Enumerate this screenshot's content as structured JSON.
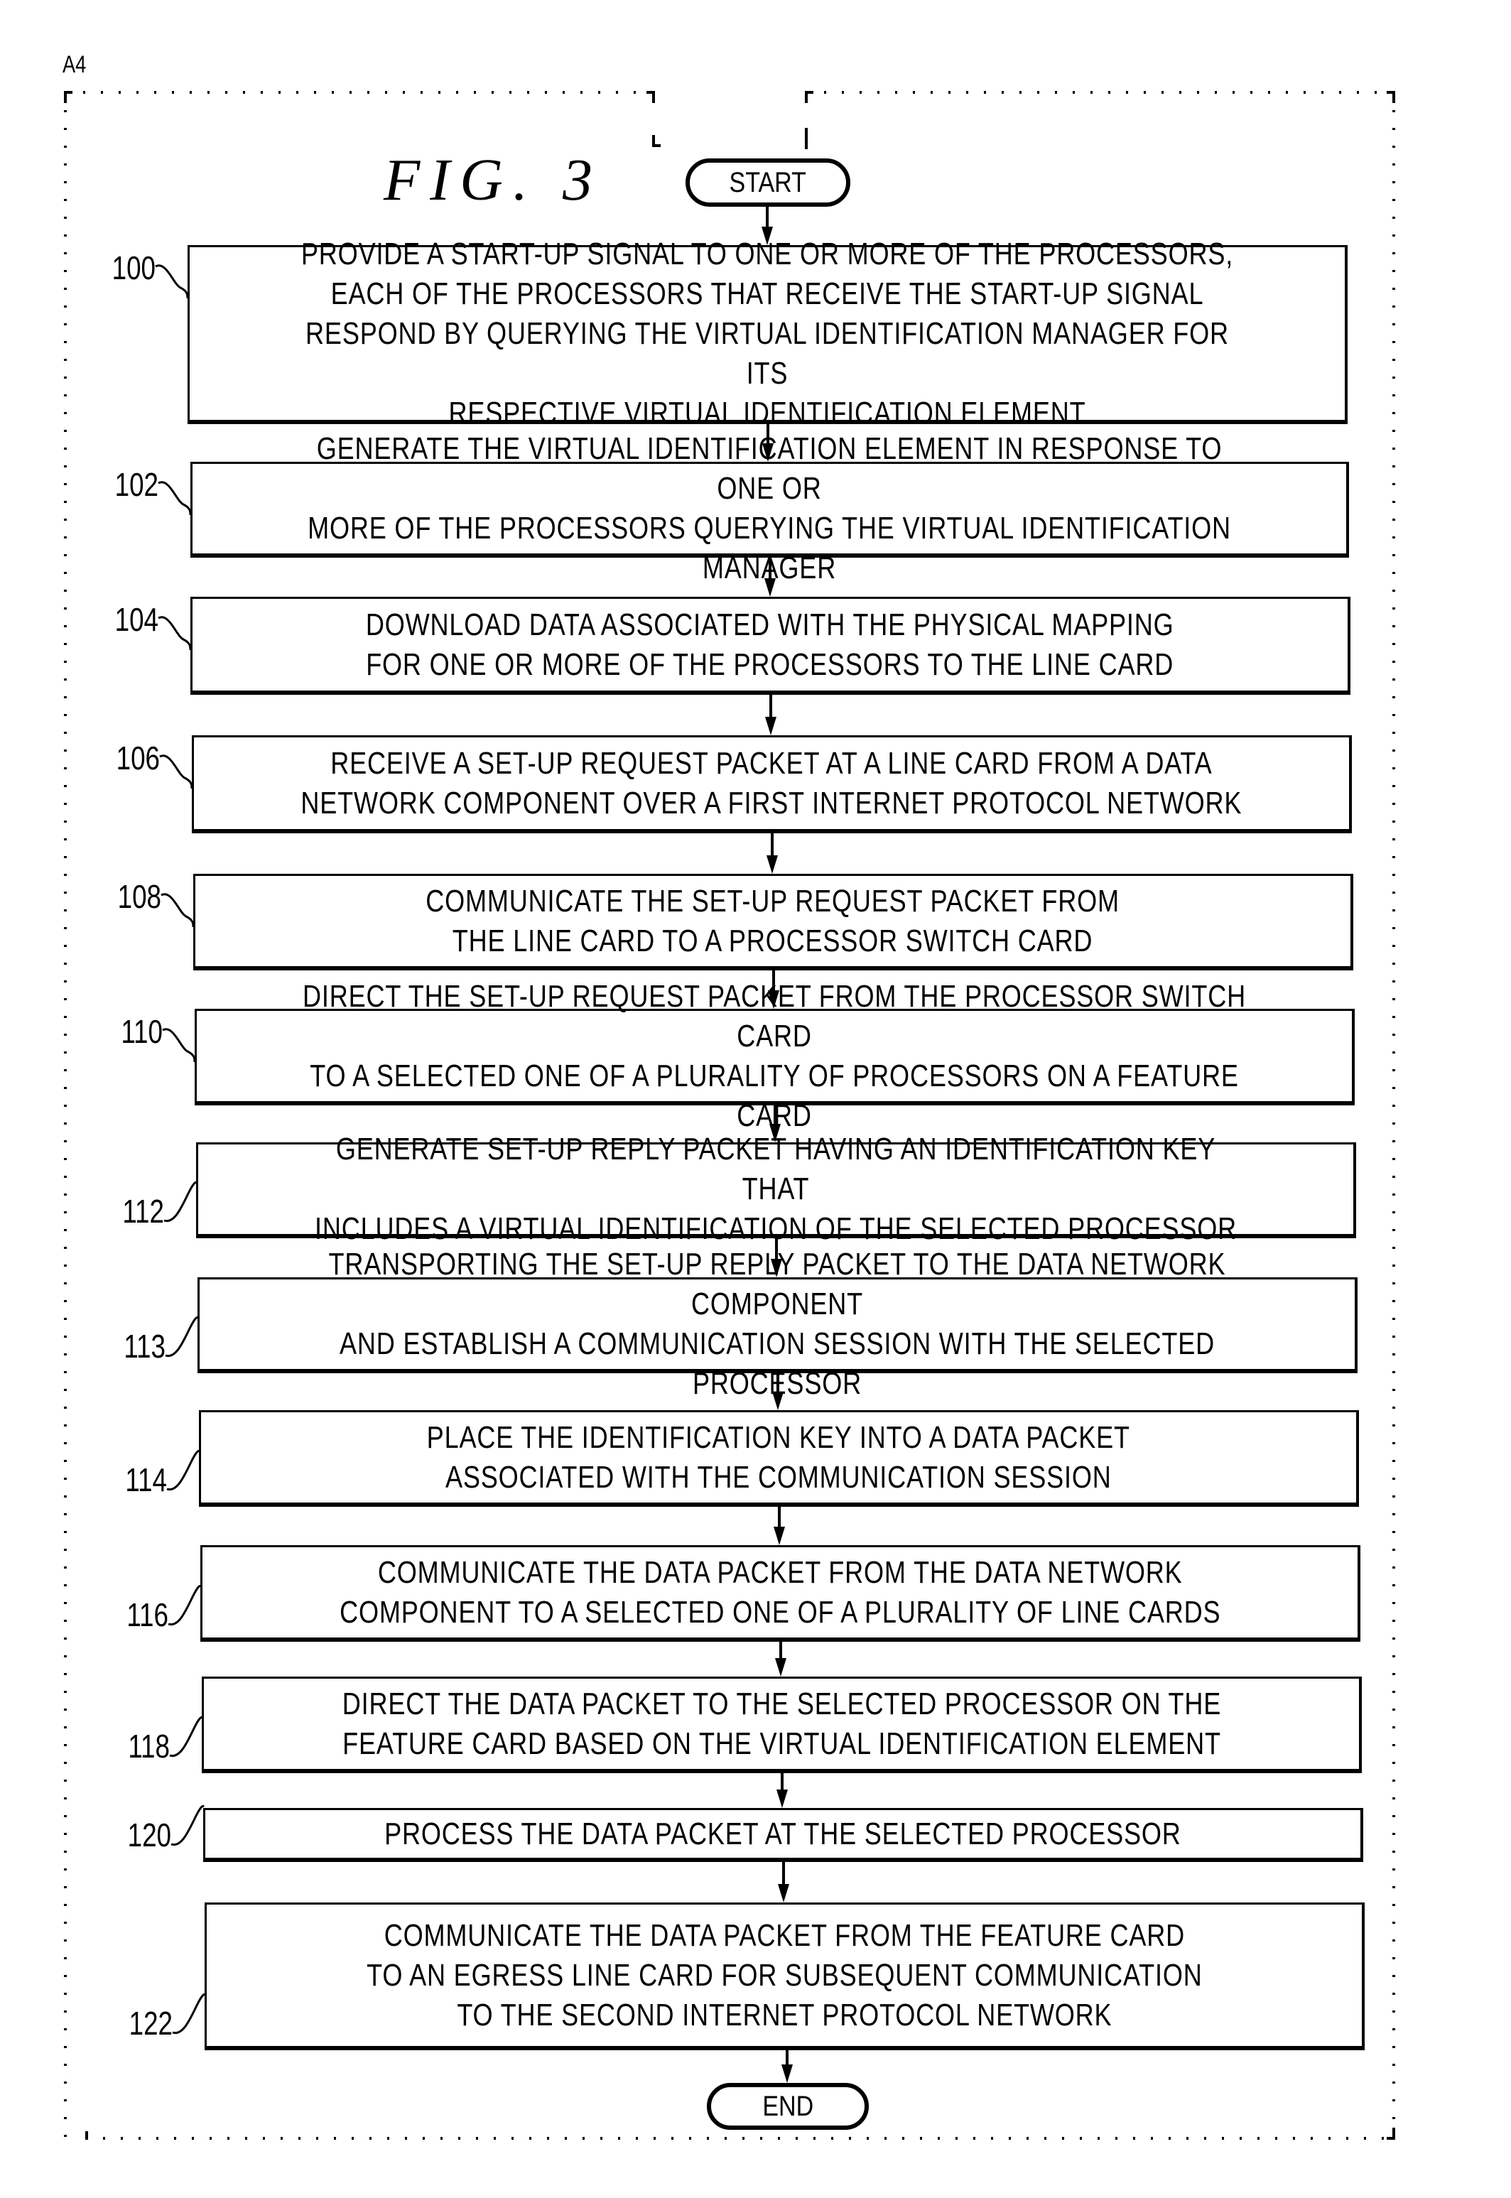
{
  "sheet_label": "A4",
  "figure_title": "FIG. 3",
  "start_label": "START",
  "end_label": "END",
  "steps": [
    {
      "id": "100",
      "text": "PROVIDE A START-UP SIGNAL TO ONE OR MORE OF THE PROCESSORS,\nEACH OF THE PROCESSORS THAT RECEIVE THE START-UP SIGNAL\nRESPOND BY QUERYING THE VIRTUAL IDENTIFICATION MANAGER FOR ITS\nRESPECTIVE VIRTUAL IDENTIFICATION ELEMENT",
      "label_side": "top"
    },
    {
      "id": "102",
      "text": "GENERATE THE VIRTUAL IDENTIFICATION ELEMENT IN RESPONSE TO ONE OR\nMORE OF THE PROCESSORS QUERYING THE VIRTUAL IDENTIFICATION MANAGER",
      "label_side": "top"
    },
    {
      "id": "104",
      "text": "DOWNLOAD DATA ASSOCIATED WITH THE PHYSICAL MAPPING\nFOR ONE OR MORE OF THE PROCESSORS TO THE LINE CARD",
      "label_side": "top"
    },
    {
      "id": "106",
      "text": "RECEIVE A SET-UP REQUEST PACKET AT A LINE CARD FROM A DATA\nNETWORK COMPONENT OVER A FIRST INTERNET PROTOCOL NETWORK",
      "label_side": "top"
    },
    {
      "id": "108",
      "text": "COMMUNICATE THE SET-UP REQUEST PACKET FROM\nTHE LINE CARD TO A PROCESSOR SWITCH CARD",
      "label_side": "top"
    },
    {
      "id": "110",
      "text": "DIRECT THE SET-UP REQUEST PACKET FROM THE PROCESSOR SWITCH CARD\nTO A SELECTED ONE OF A PLURALITY OF PROCESSORS ON A FEATURE CARD",
      "label_side": "top"
    },
    {
      "id": "112",
      "text": "GENERATE SET-UP REPLY PACKET HAVING AN IDENTIFICATION KEY THAT\nINCLUDES A VIRTUAL IDENTIFICATION OF THE SELECTED PROCESSOR",
      "label_side": "bottom"
    },
    {
      "id": "113",
      "text": "TRANSPORTING THE SET-UP REPLY PACKET TO THE DATA NETWORK COMPONENT\nAND ESTABLISH A COMMUNICATION SESSION WITH THE SELECTED PROCESSOR",
      "label_side": "bottom"
    },
    {
      "id": "114",
      "text": "PLACE THE IDENTIFICATION KEY INTO A DATA PACKET\nASSOCIATED WITH THE COMMUNICATION SESSION",
      "label_side": "bottom"
    },
    {
      "id": "116",
      "text": "COMMUNICATE THE DATA PACKET FROM THE DATA NETWORK\nCOMPONENT TO A SELECTED ONE OF A PLURALITY OF LINE CARDS",
      "label_side": "bottom"
    },
    {
      "id": "118",
      "text": "DIRECT THE DATA PACKET TO THE SELECTED PROCESSOR ON THE\nFEATURE CARD BASED ON THE VIRTUAL IDENTIFICATION ELEMENT",
      "label_side": "bottom"
    },
    {
      "id": "120",
      "text": "PROCESS THE DATA PACKET AT THE SELECTED PROCESSOR",
      "label_side": "bottom"
    },
    {
      "id": "122",
      "text": "COMMUNICATE THE DATA PACKET FROM THE FEATURE CARD\nTO AN EGRESS LINE CARD FOR SUBSEQUENT COMMUNICATION\nTO THE SECOND INTERNET PROTOCOL NETWORK",
      "label_side": "bottom"
    }
  ]
}
